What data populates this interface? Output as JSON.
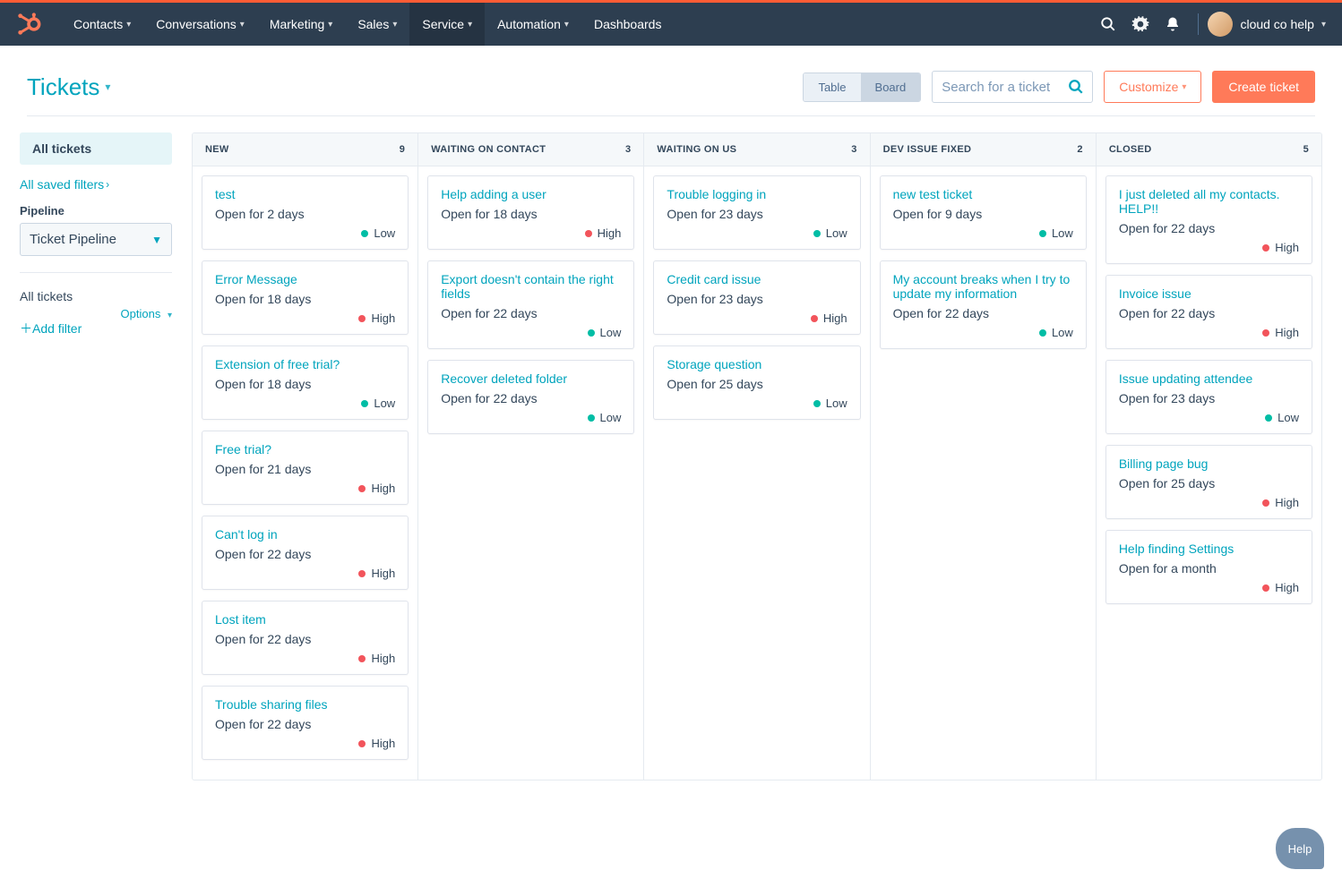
{
  "nav": {
    "items": [
      {
        "label": "Contacts"
      },
      {
        "label": "Conversations"
      },
      {
        "label": "Marketing"
      },
      {
        "label": "Sales"
      },
      {
        "label": "Service",
        "active": true
      },
      {
        "label": "Automation"
      },
      {
        "label": "Dashboards",
        "no_caret": true
      }
    ],
    "account_name": "cloud co help"
  },
  "page_title": "Tickets",
  "view_toggle": {
    "table": "Table",
    "board": "Board",
    "selected": "Board"
  },
  "search_placeholder": "Search for a ticket",
  "customize_label": "Customize",
  "create_label": "Create ticket",
  "sidebar": {
    "all_tickets": "All tickets",
    "all_saved_filters": "All saved filters",
    "pipeline_label": "Pipeline",
    "pipeline_value": "Ticket Pipeline",
    "all_tickets_2": "All tickets",
    "options": "Options",
    "add_filter": "Add filter"
  },
  "columns": [
    {
      "title": "NEW",
      "count": 9,
      "cards": [
        {
          "title": "test",
          "sub": "Open for 2 days",
          "priority": "Low"
        },
        {
          "title": "Error Message",
          "sub": "Open for 18 days",
          "priority": "High"
        },
        {
          "title": "Extension of free trial?",
          "sub": "Open for 18 days",
          "priority": "Low"
        },
        {
          "title": "Free trial?",
          "sub": "Open for 21 days",
          "priority": "High"
        },
        {
          "title": "Can't log in",
          "sub": "Open for 22 days",
          "priority": "High"
        },
        {
          "title": "Lost item",
          "sub": "Open for 22 days",
          "priority": "High"
        },
        {
          "title": "Trouble sharing files",
          "sub": "Open for 22 days",
          "priority": "High"
        }
      ]
    },
    {
      "title": "WAITING ON CONTACT",
      "count": 3,
      "cards": [
        {
          "title": "Help adding a user",
          "sub": "Open for 18 days",
          "priority": "High"
        },
        {
          "title": "Export doesn't contain the right fields",
          "sub": "Open for 22 days",
          "priority": "Low"
        },
        {
          "title": "Recover deleted folder",
          "sub": "Open for 22 days",
          "priority": "Low"
        }
      ]
    },
    {
      "title": "WAITING ON US",
      "count": 3,
      "cards": [
        {
          "title": "Trouble logging in",
          "sub": "Open for 23 days",
          "priority": "Low"
        },
        {
          "title": "Credit card issue",
          "sub": "Open for 23 days",
          "priority": "High"
        },
        {
          "title": "Storage question",
          "sub": "Open for 25 days",
          "priority": "Low"
        }
      ]
    },
    {
      "title": "DEV ISSUE FIXED",
      "count": 2,
      "cards": [
        {
          "title": "new test ticket",
          "sub": "Open for 9 days",
          "priority": "Low"
        },
        {
          "title": "My account breaks when I try to update my information",
          "sub": "Open for 22 days",
          "priority": "Low"
        }
      ]
    },
    {
      "title": "CLOSED",
      "count": 5,
      "cards": [
        {
          "title": "I just deleted all my contacts. HELP!!",
          "sub": "Open for 22 days",
          "priority": "High"
        },
        {
          "title": "Invoice issue",
          "sub": "Open for 22 days",
          "priority": "High"
        },
        {
          "title": "Issue updating attendee",
          "sub": "Open for 23 days",
          "priority": "Low"
        },
        {
          "title": "Billing page bug",
          "sub": "Open for 25 days",
          "priority": "High"
        },
        {
          "title": "Help finding Settings",
          "sub": "Open for a month",
          "priority": "High"
        }
      ]
    }
  ],
  "help_label": "Help"
}
